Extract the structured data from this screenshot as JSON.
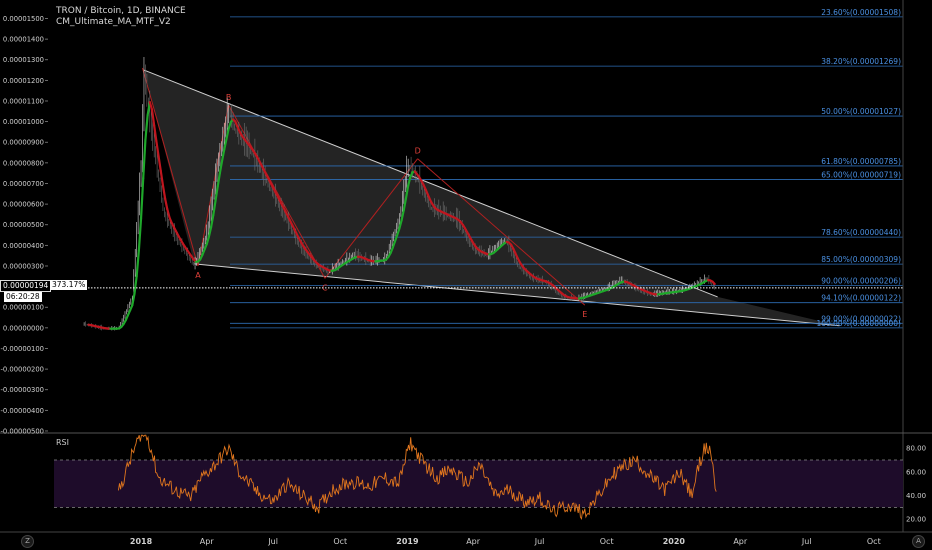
{
  "header": {
    "symbol_line": "TRON / Bitcoin, 1D, BINANCE",
    "indicator_line": "CM_Ultimate_MA_MTF_V2"
  },
  "price_badge": {
    "price": "0.00000194",
    "percent": "373.17%",
    "countdown": "06:20:28"
  },
  "rsi_panel": {
    "label": "RSI"
  },
  "icons": {
    "bottom_left": "timezone-icon",
    "bottom_right": "auto-scale-icon"
  },
  "colors": {
    "background": "#000000",
    "fib_line": "#2d6db5",
    "fib_text": "#4a90e2",
    "wedge_fill": "#2a2a2a",
    "wedge_line": "#cfcfcf",
    "wave_line": "#b02020",
    "wave_label": "#e0413a",
    "ma_green": "#1fa82b",
    "ma_red": "#c0161f",
    "rsi_line": "#e0761e",
    "rsi_band": "#1e0c2a"
  },
  "chart_data": [
    {
      "type": "line",
      "name": "price",
      "y_axis_ticks": [
        "0.00001500",
        "0.00001400",
        "0.00001300",
        "0.00001200",
        "0.00001100",
        "0.00001000",
        "0.00000900",
        "0.00000800",
        "0.00000700",
        "0.00000600",
        "0.00000500",
        "0.00000400",
        "0.00000300",
        "0.00000200",
        "0.00000100",
        "0.00000000",
        "-0.00000100",
        "-0.00000200",
        "-0.00000300",
        "-0.00000400",
        "-0.00000500"
      ],
      "y_values": [
        1.5e-05,
        1.4e-05,
        1.3e-05,
        1.2e-05,
        1.1e-05,
        1e-05,
        9e-06,
        8e-06,
        7e-06,
        6e-06,
        5e-06,
        4e-06,
        3e-06,
        2e-06,
        1e-06,
        0,
        -1e-06,
        -2e-06,
        -3e-06,
        -4e-06,
        -5e-06
      ],
      "ylim": [
        -5.05e-06,
        1.58e-05
      ],
      "x_axis_ticks": [
        "2018",
        "Apr",
        "Jul",
        "Oct",
        "2019",
        "Apr",
        "Jul",
        "Oct",
        "2020",
        "Apr",
        "Jul",
        "Oct"
      ],
      "x_tick_dates": [
        "2018-01-01",
        "2018-04-01",
        "2018-07-01",
        "2018-10-01",
        "2019-01-01",
        "2019-04-01",
        "2019-07-01",
        "2019-10-01",
        "2020-01-01",
        "2020-04-01",
        "2020-07-01",
        "2020-10-01"
      ],
      "xlim": [
        "2017-09-01",
        "2020-11-10"
      ],
      "grid": false,
      "series": [
        {
          "x": [
            "2017-10-15",
            "2017-11-10",
            "2017-12-01",
            "2017-12-20",
            "2018-01-01",
            "2018-01-05",
            "2018-01-15",
            "2018-02-01",
            "2018-02-20",
            "2018-03-15",
            "2018-04-01",
            "2018-04-15",
            "2018-05-01",
            "2018-05-10",
            "2018-06-01",
            "2018-06-20",
            "2018-07-15",
            "2018-08-05",
            "2018-08-25",
            "2018-09-15",
            "2018-10-01",
            "2018-10-20",
            "2018-11-10",
            "2018-12-01",
            "2018-12-20",
            "2019-01-01",
            "2019-01-15",
            "2019-02-01",
            "2019-02-20",
            "2019-03-10",
            "2019-04-01",
            "2019-04-20",
            "2019-05-15",
            "2019-06-01",
            "2019-06-20",
            "2019-07-10",
            "2019-08-01",
            "2019-08-20",
            "2019-09-15",
            "2019-10-01",
            "2019-10-20",
            "2019-11-10",
            "2019-12-01",
            "2019-12-20",
            "2020-01-10",
            "2020-02-01",
            "2020-02-15",
            "2020-02-26"
          ],
          "y": [
            1.7e-07,
            -4e-08,
            -4e-08,
            1.5e-06,
            8e-06,
            1.22e-05,
            9.5e-06,
            5.5e-06,
            4.2e-06,
            3e-06,
            4.5e-06,
            7.8e-06,
            1.05e-05,
            9.5e-06,
            8.5e-06,
            7.2e-06,
            5.5e-06,
            4e-06,
            3.1e-06,
            2.7e-06,
            3.1e-06,
            3.5e-06,
            3.2e-06,
            3.3e-06,
            5.2e-06,
            7.8e-06,
            7.2e-06,
            5.8e-06,
            5.5e-06,
            5.2e-06,
            3.8e-06,
            3.5e-06,
            4.3e-06,
            3e-06,
            2.4e-06,
            2.2e-06,
            1.5e-06,
            1.4e-06,
            1.7e-06,
            1.9e-06,
            2.3e-06,
            1.9e-06,
            1.6e-06,
            1.7e-06,
            1.8e-06,
            2.1e-06,
            2.4e-06,
            1.9e-06
          ]
        }
      ],
      "fibonacci_levels": [
        {
          "label": "23.60%(0.00001508)",
          "value": 1.508e-05
        },
        {
          "label": "38.20%(0.00001269)",
          "value": 1.269e-05
        },
        {
          "label": "50.00%(0.00001027)",
          "value": 1.027e-05
        },
        {
          "label": "61.80%(0.00000785)",
          "value": 7.85e-06
        },
        {
          "label": "65.00%(0.00000719)",
          "value": 7.19e-06
        },
        {
          "label": "78.60%(0.00000440)",
          "value": 4.4e-06
        },
        {
          "label": "85.00%(0.00000309)",
          "value": 3.09e-06
        },
        {
          "label": "90.00%(0.00000206)",
          "value": 2.06e-06
        },
        {
          "label": "94.10%(0.00000122)",
          "value": 1.22e-06
        },
        {
          "label": "99.00%(0.00000022)",
          "value": 2.2e-07
        },
        {
          "label": "100.00%(0.00000000)",
          "value": 0
        }
      ],
      "wave_points": [
        {
          "label": "",
          "date": "2018-01-03",
          "value": 1.26e-05
        },
        {
          "label": "A",
          "date": "2018-03-20",
          "value": 3e-06
        },
        {
          "label": "B",
          "date": "2018-05-01",
          "value": 1.08e-05
        },
        {
          "label": "C",
          "date": "2018-09-10",
          "value": 2.4e-06
        },
        {
          "label": "D",
          "date": "2019-01-15",
          "value": 8.2e-06
        },
        {
          "label": "E",
          "date": "2019-09-01",
          "value": 1.1e-06
        }
      ],
      "wedge": {
        "upper": {
          "start_date": "2018-01-05",
          "start_value": 1.25e-05,
          "end_date": "2020-03-01",
          "end_value": 1.5e-06
        },
        "lower": {
          "start_date": "2018-03-15",
          "start_value": 3.1e-06,
          "end_date": "2020-08-15",
          "end_value": 1e-07
        }
      },
      "last_price": 1.94e-06
    },
    {
      "type": "line",
      "name": "rsi",
      "y_axis_ticks": [
        "80.00",
        "60.00",
        "40.00",
        "20.00"
      ],
      "y_values": [
        80,
        60,
        40,
        20
      ],
      "ylim": [
        10,
        92
      ],
      "bands": [
        30,
        70
      ],
      "x": [
        "2017-12-01",
        "2017-12-20",
        "2018-01-01",
        "2018-01-10",
        "2018-01-25",
        "2018-02-15",
        "2018-03-10",
        "2018-03-25",
        "2018-04-15",
        "2018-05-01",
        "2018-05-15",
        "2018-06-10",
        "2018-07-01",
        "2018-07-20",
        "2018-08-10",
        "2018-09-01",
        "2018-09-20",
        "2018-10-15",
        "2018-11-10",
        "2018-12-01",
        "2018-12-20",
        "2019-01-05",
        "2019-01-20",
        "2019-02-10",
        "2019-03-01",
        "2019-03-25",
        "2019-04-10",
        "2019-05-01",
        "2019-05-20",
        "2019-06-10",
        "2019-07-01",
        "2019-07-20",
        "2019-08-10",
        "2019-09-01",
        "2019-09-20",
        "2019-10-10",
        "2019-10-25",
        "2019-11-10",
        "2019-12-01",
        "2019-12-20",
        "2020-01-10",
        "2020-01-25",
        "2020-02-10",
        "2020-02-20",
        "2020-02-28"
      ],
      "y": [
        42,
        75,
        93,
        90,
        55,
        45,
        38,
        55,
        68,
        80,
        60,
        42,
        35,
        50,
        40,
        30,
        45,
        52,
        48,
        55,
        50,
        85,
        70,
        55,
        62,
        50,
        66,
        40,
        45,
        35,
        38,
        26,
        32,
        25,
        40,
        58,
        65,
        70,
        55,
        45,
        60,
        40,
        78,
        80,
        42
      ]
    }
  ]
}
